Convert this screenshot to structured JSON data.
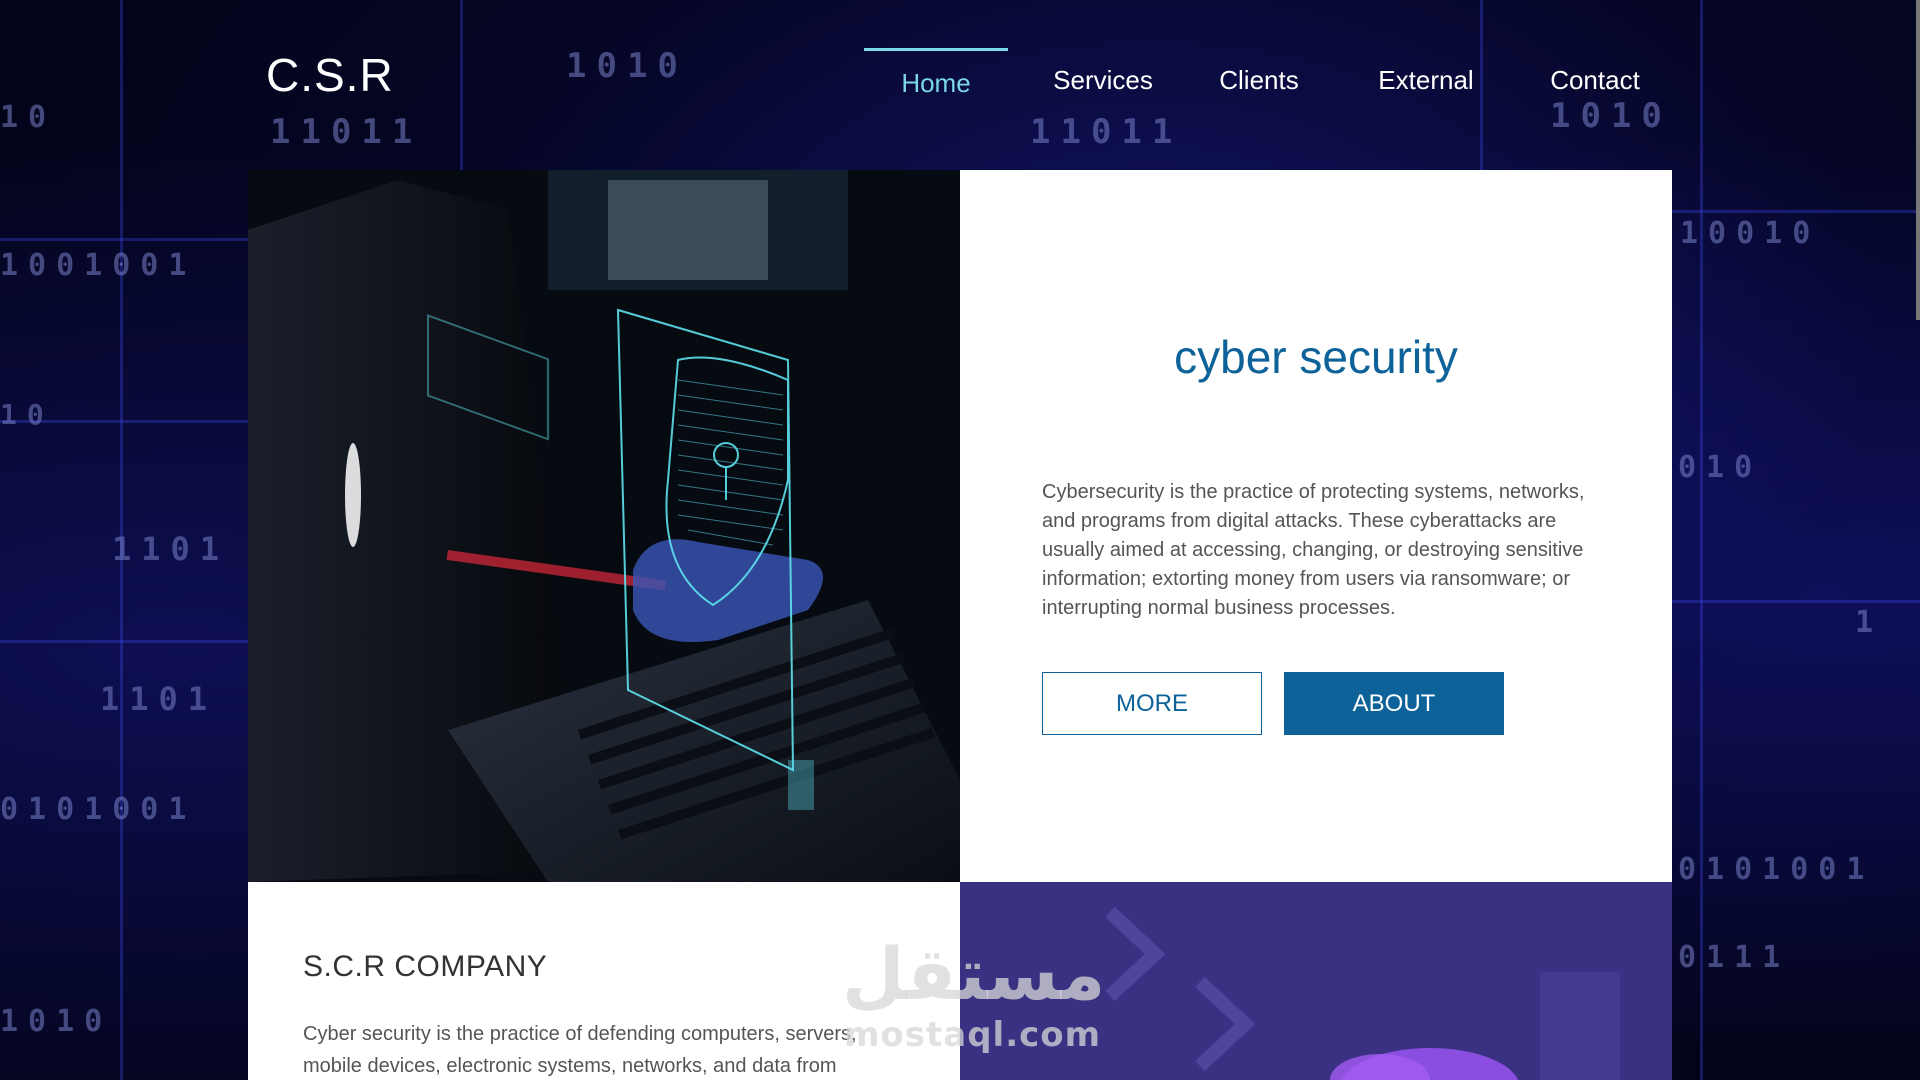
{
  "brand": {
    "logo": "C.S.R"
  },
  "nav": {
    "items": [
      {
        "label": "Home",
        "active": true
      },
      {
        "label": "Services",
        "active": false
      },
      {
        "label": "Clients",
        "active": false
      },
      {
        "label": "External",
        "active": false
      },
      {
        "label": "Contact",
        "active": false
      }
    ]
  },
  "hero": {
    "image": "laptop-hacker-shield-lock-image",
    "title": "cyber security",
    "text": "Cybersecurity is the practice of protecting systems, networks, and programs from digital attacks. These cyberattacks are usually aimed at accessing, changing, or destroying sensitive information; extorting money from users via ransomware; or interrupting normal business processes.",
    "more_label": "MORE",
    "about_label": "ABOUT"
  },
  "company": {
    "title": "S.C.R COMPANY",
    "text": "Cyber security is the practice of defending computers, servers, mobile devices, electronic systems, networks, and data from"
  },
  "background": {
    "binary": [
      "1010",
      "11011",
      "11011",
      "1010",
      "1001001",
      "10010",
      "10",
      "1101",
      "1101",
      "1010",
      "010",
      "0101001",
      "1",
      "0111",
      "10",
      "0101001"
    ]
  },
  "watermark": {
    "arabic": "مستقل",
    "latin": "mostaql.com"
  },
  "colors": {
    "accent": "#0d6299",
    "nav_active": "#7ad8e8",
    "purple_panel": "#3b3182",
    "background": "#03041a"
  }
}
